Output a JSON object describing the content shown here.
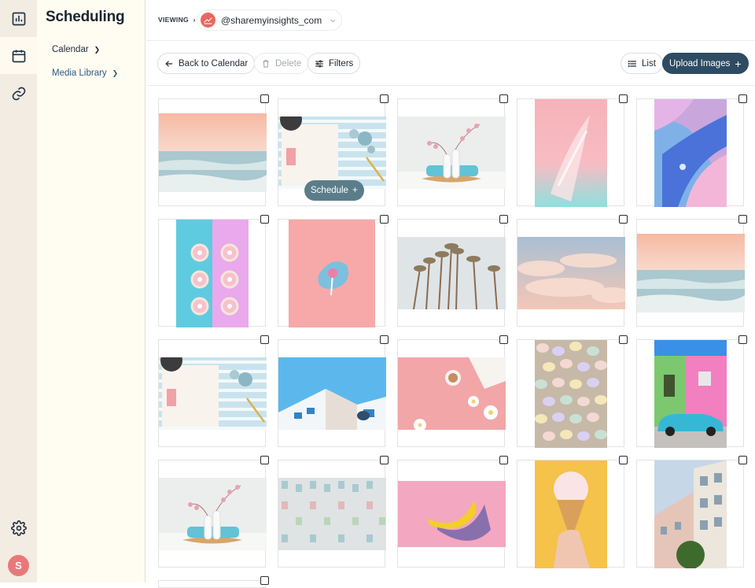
{
  "app": {
    "title": "Scheduling"
  },
  "rail": {
    "avatar_initial": "S"
  },
  "subnav": {
    "items": [
      {
        "label": "Calendar"
      },
      {
        "label": "Media Library"
      }
    ]
  },
  "topbar": {
    "viewing_label": "VIEWING",
    "viewing_sep": "›",
    "account_name": "@sharemyinsights_com"
  },
  "toolbar": {
    "back_label": "Back to Calendar",
    "delete_label": "Delete",
    "filters_label": "Filters",
    "list_label": "List",
    "upload_label": "Upload Images",
    "upload_plus": "+"
  },
  "hover": {
    "schedule_label": "Schedule",
    "schedule_plus": "+"
  },
  "colors": {
    "brand_dark": "#2d4b63",
    "rail_bg": "#f3ece2",
    "subnav_bg": "#fffcf2",
    "active_link": "#2d5a85",
    "avatar": "#e8797a"
  },
  "media": [
    {
      "subject": "pastel ocean horizon",
      "orientation": "landscape"
    },
    {
      "subject": "planner with striped mat",
      "orientation": "landscape"
    },
    {
      "subject": "vases with cherry blossom",
      "orientation": "landscape"
    },
    {
      "subject": "pink and teal brushstroke",
      "orientation": "portrait"
    },
    {
      "subject": "blue pink marble swirl",
      "orientation": "portrait"
    },
    {
      "subject": "donuts on pink and blue",
      "orientation": "portrait"
    },
    {
      "subject": "lollipop on pink",
      "orientation": "portrait"
    },
    {
      "subject": "palm trees",
      "orientation": "landscape"
    },
    {
      "subject": "pastel clouds",
      "orientation": "landscape"
    },
    {
      "subject": "pastel ocean horizon",
      "orientation": "landscape"
    },
    {
      "subject": "planner with striped mat",
      "orientation": "landscape"
    },
    {
      "subject": "white building blue sky",
      "orientation": "landscape"
    },
    {
      "subject": "coffee and daisies on pink",
      "orientation": "landscape"
    },
    {
      "subject": "pastel candy eggs",
      "orientation": "portrait"
    },
    {
      "subject": "pink house blue car",
      "orientation": "portrait"
    },
    {
      "subject": "vases with cherry blossom",
      "orientation": "landscape"
    },
    {
      "subject": "pastel building facade",
      "orientation": "landscape"
    },
    {
      "subject": "banana on pink",
      "orientation": "landscape"
    },
    {
      "subject": "ice cream cone",
      "orientation": "portrait"
    },
    {
      "subject": "apartment buildings",
      "orientation": "portrait"
    }
  ]
}
